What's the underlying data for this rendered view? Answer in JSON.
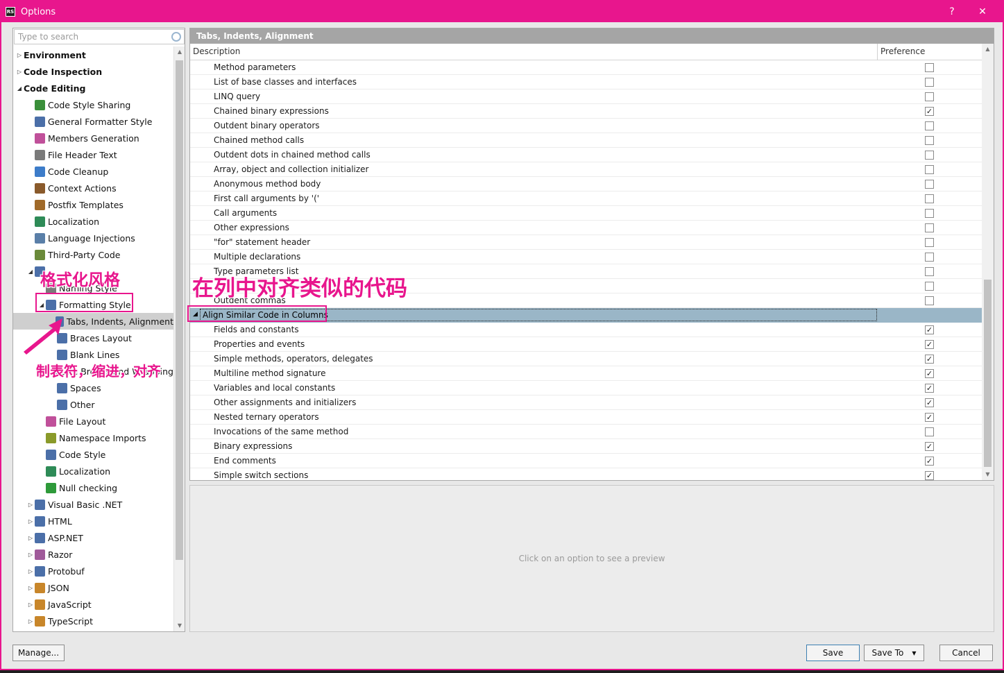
{
  "window": {
    "title": "Options",
    "app_icon": "RS",
    "help_label": "?",
    "close_label": "✕"
  },
  "search": {
    "placeholder": "Type to search"
  },
  "tree": [
    {
      "label": "Environment",
      "bold": true,
      "level": 0,
      "arrow": "right",
      "icon": ""
    },
    {
      "label": "Code Inspection",
      "bold": true,
      "level": 0,
      "arrow": "right",
      "icon": ""
    },
    {
      "label": "Code Editing",
      "bold": true,
      "level": 0,
      "arrow": "down",
      "icon": ""
    },
    {
      "label": "Code Style Sharing",
      "level": 1,
      "icon": "code-style-sharing-icon",
      "color": "#3a8f3a"
    },
    {
      "label": "General Formatter Style",
      "level": 1,
      "icon": "formatter-style-icon",
      "color": "#4b6fa8"
    },
    {
      "label": "Members Generation",
      "level": 1,
      "icon": "members-generation-icon",
      "color": "#c0509a"
    },
    {
      "label": "File Header Text",
      "level": 1,
      "icon": "file-header-icon",
      "color": "#7a7a7a"
    },
    {
      "label": "Code Cleanup",
      "level": 1,
      "icon": "code-cleanup-icon",
      "color": "#3d7cc9"
    },
    {
      "label": "Context Actions",
      "level": 1,
      "icon": "context-actions-icon",
      "color": "#8a5a2b"
    },
    {
      "label": "Postfix Templates",
      "level": 1,
      "icon": "postfix-templates-icon",
      "color": "#a06a2a"
    },
    {
      "label": "Localization",
      "level": 1,
      "icon": "localization-icon",
      "color": "#2e8b57"
    },
    {
      "label": "Language Injections",
      "level": 1,
      "icon": "language-injections-icon",
      "color": "#5a7fa8"
    },
    {
      "label": "Third-Party Code",
      "level": 1,
      "icon": "third-party-code-icon",
      "color": "#6a8a3a"
    },
    {
      "label": "",
      "level": 1,
      "arrow": "down",
      "icon": "csharp-icon",
      "color": "#4b6fa8"
    },
    {
      "label": "Naming Style",
      "level": 2,
      "icon": "naming-style-icon",
      "color": "#7a7a7a"
    },
    {
      "label": "Formatting Style",
      "level": 2,
      "arrow": "down",
      "icon": "formatting-style-icon",
      "color": "#4b6fa8"
    },
    {
      "label": "Tabs, Indents, Alignment",
      "level": 3,
      "icon": "tabs-indents-icon",
      "color": "#4b6fa8",
      "selected": true
    },
    {
      "label": "Braces Layout",
      "level": 3,
      "icon": "braces-layout-icon",
      "color": "#4b6fa8"
    },
    {
      "label": "Blank Lines",
      "level": 3,
      "icon": "blank-lines-icon",
      "color": "#4b6fa8"
    },
    {
      "label": "Line Breaks and Wrapping",
      "level": 3,
      "icon": "line-breaks-icon",
      "color": "#4b6fa8"
    },
    {
      "label": "Spaces",
      "level": 3,
      "icon": "spaces-icon",
      "color": "#4b6fa8"
    },
    {
      "label": "Other",
      "level": 3,
      "icon": "other-icon",
      "color": "#4b6fa8"
    },
    {
      "label": "File Layout",
      "level": 2,
      "icon": "file-layout-icon",
      "color": "#c0509a"
    },
    {
      "label": "Namespace Imports",
      "level": 2,
      "icon": "namespace-imports-icon",
      "color": "#8a9a2a"
    },
    {
      "label": "Code Style",
      "level": 2,
      "icon": "code-style-icon",
      "color": "#4b6fa8"
    },
    {
      "label": "Localization",
      "level": 2,
      "icon": "localization-icon",
      "color": "#2e8b57"
    },
    {
      "label": "Null checking",
      "level": 2,
      "icon": "null-checking-icon",
      "color": "#2e9a3a"
    },
    {
      "label": "Visual Basic .NET",
      "level": 1,
      "arrow": "right",
      "icon": "vb-icon",
      "color": "#4b6fa8"
    },
    {
      "label": "HTML",
      "level": 1,
      "arrow": "right",
      "icon": "html-icon",
      "color": "#4b6fa8"
    },
    {
      "label": "ASP.NET",
      "level": 1,
      "arrow": "right",
      "icon": "aspnet-icon",
      "color": "#4b6fa8"
    },
    {
      "label": "Razor",
      "level": 1,
      "arrow": "right",
      "icon": "razor-icon",
      "color": "#a05a9a"
    },
    {
      "label": "Protobuf",
      "level": 1,
      "arrow": "right",
      "icon": "protobuf-icon",
      "color": "#4b6fa8"
    },
    {
      "label": "JSON",
      "level": 1,
      "arrow": "right",
      "icon": "json-icon",
      "color": "#c8862a"
    },
    {
      "label": "JavaScript",
      "level": 1,
      "arrow": "right",
      "icon": "javascript-icon",
      "color": "#c8862a"
    },
    {
      "label": "TypeScript",
      "level": 1,
      "arrow": "right",
      "icon": "typescript-icon",
      "color": "#c8862a"
    }
  ],
  "panel": {
    "title": "Tabs, Indents, Alignment",
    "col_description": "Description",
    "col_preference": "Preference",
    "preview_hint": "Click on an option to see a preview"
  },
  "options": [
    {
      "label": "Method parameters",
      "checked": false
    },
    {
      "label": "List of base classes and interfaces",
      "checked": false
    },
    {
      "label": "LINQ query",
      "checked": false
    },
    {
      "label": "Chained binary expressions",
      "checked": true
    },
    {
      "label": "Outdent binary operators",
      "checked": false
    },
    {
      "label": "Chained method calls",
      "checked": false
    },
    {
      "label": "Outdent dots in chained method calls",
      "checked": false
    },
    {
      "label": "Array, object and collection initializer",
      "checked": false
    },
    {
      "label": "Anonymous method body",
      "checked": false
    },
    {
      "label": "First call arguments by '('",
      "checked": false
    },
    {
      "label": "Call arguments",
      "checked": false
    },
    {
      "label": "Other expressions",
      "checked": false
    },
    {
      "label": "\"for\" statement header",
      "checked": false
    },
    {
      "label": "Multiple declarations",
      "checked": false
    },
    {
      "label": "Type parameters list",
      "checked": false
    },
    {
      "label": "",
      "checked": false
    },
    {
      "label": "Outdent commas",
      "checked": false
    },
    {
      "group": true,
      "label": "Align Similar Code in Columns"
    },
    {
      "label": "Fields and constants",
      "checked": true
    },
    {
      "label": "Properties and events",
      "checked": true
    },
    {
      "label": "Simple methods, operators, delegates",
      "checked": true
    },
    {
      "label": "Multiline method signature",
      "checked": true
    },
    {
      "label": "Variables and local constants",
      "checked": true
    },
    {
      "label": "Other assignments and initializers",
      "checked": true
    },
    {
      "label": "Nested ternary operators",
      "checked": true
    },
    {
      "label": "Invocations of the same method",
      "checked": false
    },
    {
      "label": "Binary expressions",
      "checked": true
    },
    {
      "label": "End comments",
      "checked": true
    },
    {
      "label": "Simple switch sections",
      "checked": true
    }
  ],
  "buttons": {
    "manage": "Manage...",
    "save": "Save",
    "save_to": "Save To",
    "cancel": "Cancel"
  },
  "annotations": {
    "formatting_style": "格式化风格",
    "align_columns": "在列中对齐类似的代码",
    "tabs_indents": "制表符，缩进，对齐"
  },
  "colors": {
    "accent": "#e8168d",
    "group_row": "#9ab6c7",
    "selected_row": "#cfcfcf"
  }
}
